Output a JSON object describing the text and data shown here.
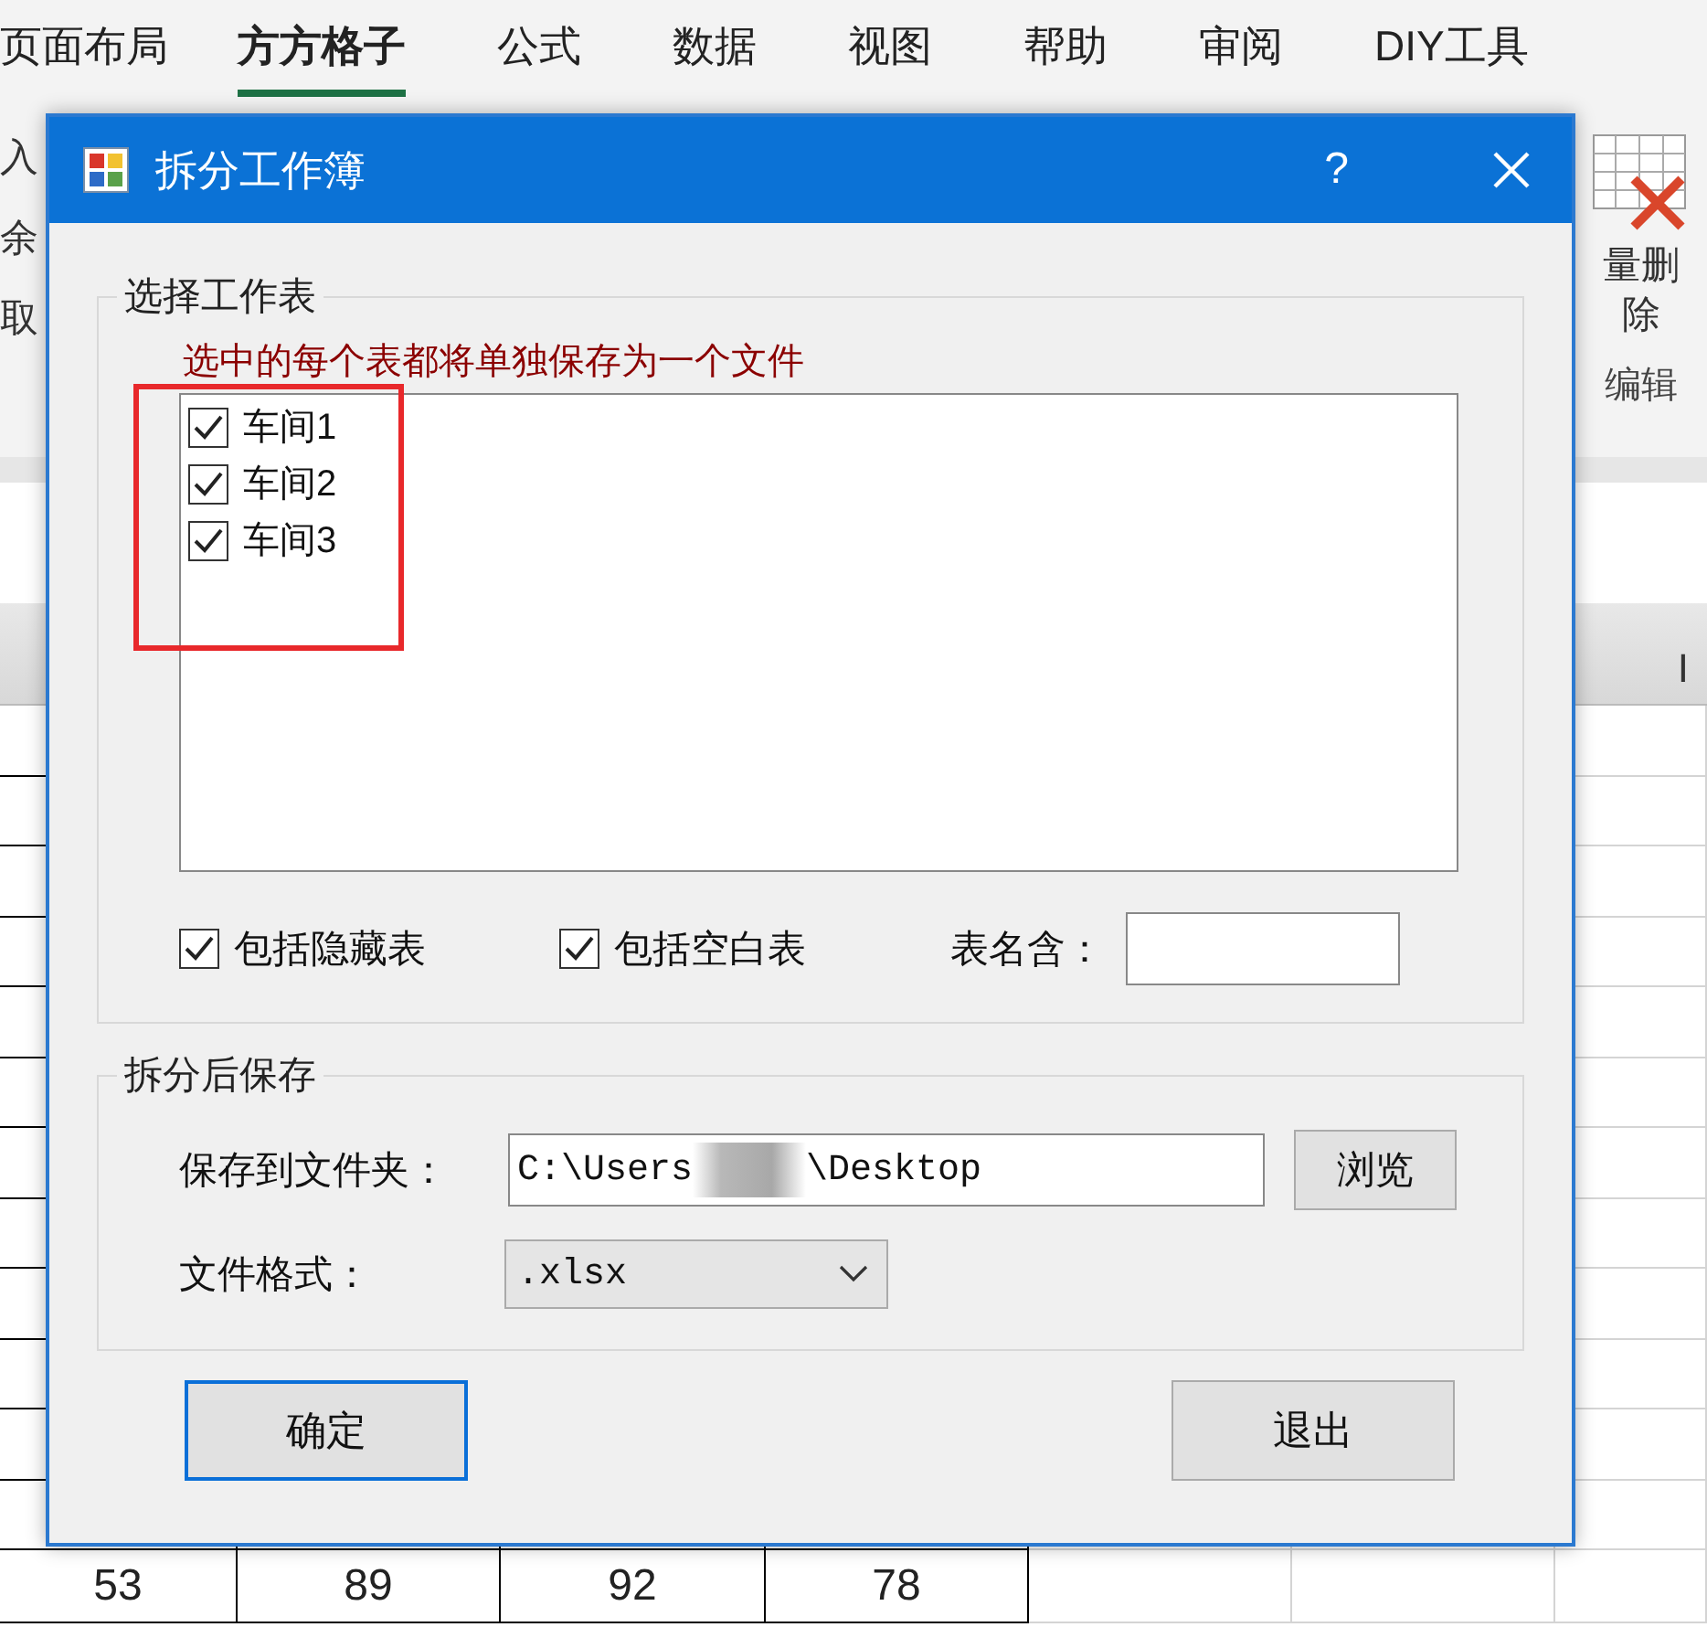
{
  "ribbon": {
    "tabs": [
      {
        "label": "页面布局",
        "selected": false
      },
      {
        "label": "方方格子",
        "selected": true
      },
      {
        "label": "公式",
        "selected": false
      },
      {
        "label": "数据",
        "selected": false
      },
      {
        "label": "视图",
        "selected": false
      },
      {
        "label": "帮助",
        "selected": false
      },
      {
        "label": "审阅",
        "selected": false
      },
      {
        "label": "DIY工具",
        "selected": false
      }
    ],
    "left_fragments": [
      "入",
      "余",
      "取"
    ],
    "delete_button": {
      "lines": [
        "量删",
        "除"
      ]
    },
    "group_label": "编辑"
  },
  "sheet": {
    "column_header": "I",
    "last_row": [
      "53",
      "89",
      "92",
      "78"
    ]
  },
  "dialog": {
    "title": "拆分工作簿",
    "help": "?",
    "sheet_group": {
      "legend": "选择工作表",
      "hint": "选中的每个表都将单独保存为一个文件",
      "annotation_box": true,
      "sheets": [
        {
          "label": "车间1",
          "checked": true
        },
        {
          "label": "车间2",
          "checked": true
        },
        {
          "label": "车间3",
          "checked": true
        }
      ],
      "options": [
        {
          "label": "包括隐藏表",
          "checked": true
        },
        {
          "label": "包括空白表",
          "checked": true
        }
      ],
      "name_filter": {
        "label": "表名含："
      }
    },
    "save_group": {
      "legend": "拆分后保存",
      "folder": {
        "label": "保存到文件夹：",
        "value_start": "C:\\Users",
        "value_end": "\\Desktop",
        "redacted": true
      },
      "browse": "浏览",
      "format": {
        "label": "文件格式：",
        "value": ".xlsx"
      }
    },
    "buttons": [
      {
        "label": "确定",
        "default": true
      },
      {
        "label": "退出",
        "default": false
      }
    ]
  }
}
